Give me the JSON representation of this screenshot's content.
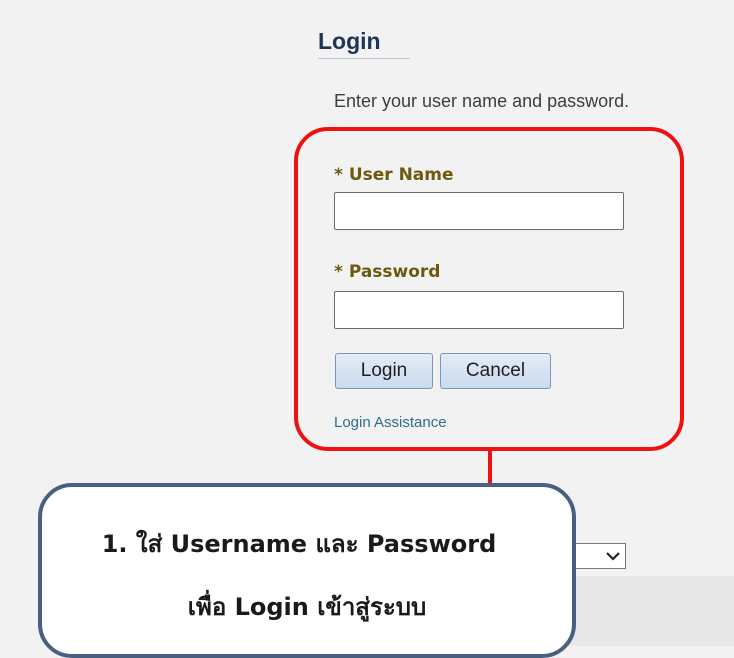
{
  "login_form": {
    "title": "Login",
    "instructions": "Enter your user name and password.",
    "username": {
      "required_marker": "*",
      "label": "User Name",
      "value": ""
    },
    "password": {
      "required_marker": "*",
      "label": "Password",
      "value": ""
    },
    "login_button": "Login",
    "cancel_button": "Cancel",
    "assistance_link": "Login Assistance"
  },
  "callout": {
    "line1": "1.  ใส่ Username และ Password",
    "line2": "เพื่อ Login เข้าสู่ระบบ"
  },
  "colors": {
    "highlight": "#ee1111",
    "callout_border": "#4a5f80",
    "label": "#6b5a10",
    "link": "#2e6d8e",
    "title": "#1f3556"
  },
  "icons": {
    "select_arrow": "chevron-down-icon"
  }
}
